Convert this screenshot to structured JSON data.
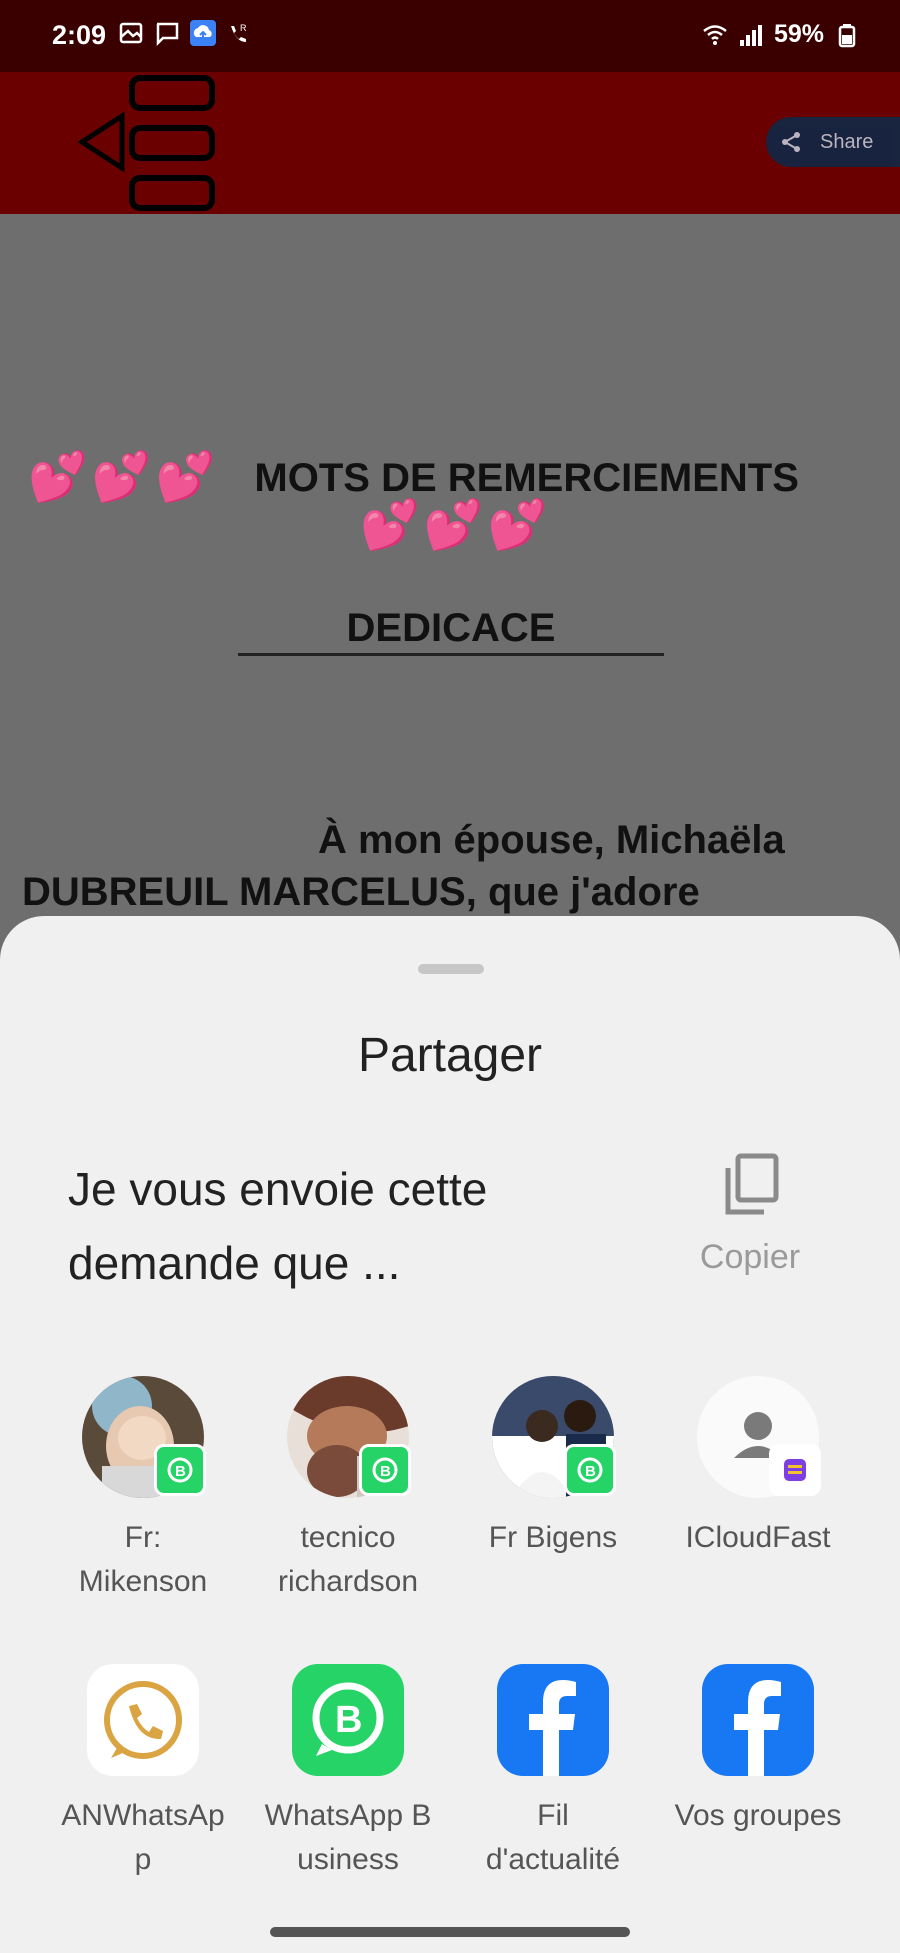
{
  "status_bar": {
    "time": "2:09",
    "battery": "59%",
    "icons_left": [
      "gallery-icon",
      "message-icon",
      "cloud-upload-icon",
      "wifi-calling-icon"
    ],
    "icons_right": [
      "wifi-icon",
      "signal-icon",
      "battery-icon"
    ]
  },
  "app_bar": {
    "share_label": "Share",
    "background": "#6b0000"
  },
  "document": {
    "title": "MOTS DE REMERCIEMENTS",
    "hearts": "💕💕💕",
    "subtitle": "DEDICACE",
    "paragraph": "À mon épouse, Michaëla DUBREUIL MARCELUS, que j'adore"
  },
  "share_sheet": {
    "title": "Partager",
    "preview_text": "Je vous envoie cette demande que ...",
    "copy_label": "Copier",
    "contacts": [
      {
        "label_line1": "Fr:",
        "label_line2": "Mikenson",
        "badge": "whatsapp-business-badge"
      },
      {
        "label_line1": "tecnico",
        "label_line2": "richardson",
        "badge": "whatsapp-business-badge"
      },
      {
        "label_line1": "Fr Bigens",
        "label_line2": "",
        "badge": "whatsapp-business-badge"
      },
      {
        "label_line1": "ICloudFast",
        "label_line2": "",
        "badge": "app-badge"
      }
    ],
    "apps": [
      {
        "label_line1": "ANWhatsAp",
        "label_line2": "p",
        "icon": "anwhatsapp-icon"
      },
      {
        "label_line1": "WhatsApp B",
        "label_line2": "usiness",
        "icon": "whatsapp-business-icon"
      },
      {
        "label_line1": "Fil",
        "label_line2": "d'actualité",
        "icon": "facebook-icon"
      },
      {
        "label_line1": "Vos groupes",
        "label_line2": "",
        "icon": "facebook-icon"
      }
    ]
  },
  "colors": {
    "status_bar": "#3a0000",
    "whatsapp_green": "#25d366",
    "facebook_blue": "#1877f2",
    "sheet_bg": "#f0f0f0"
  }
}
